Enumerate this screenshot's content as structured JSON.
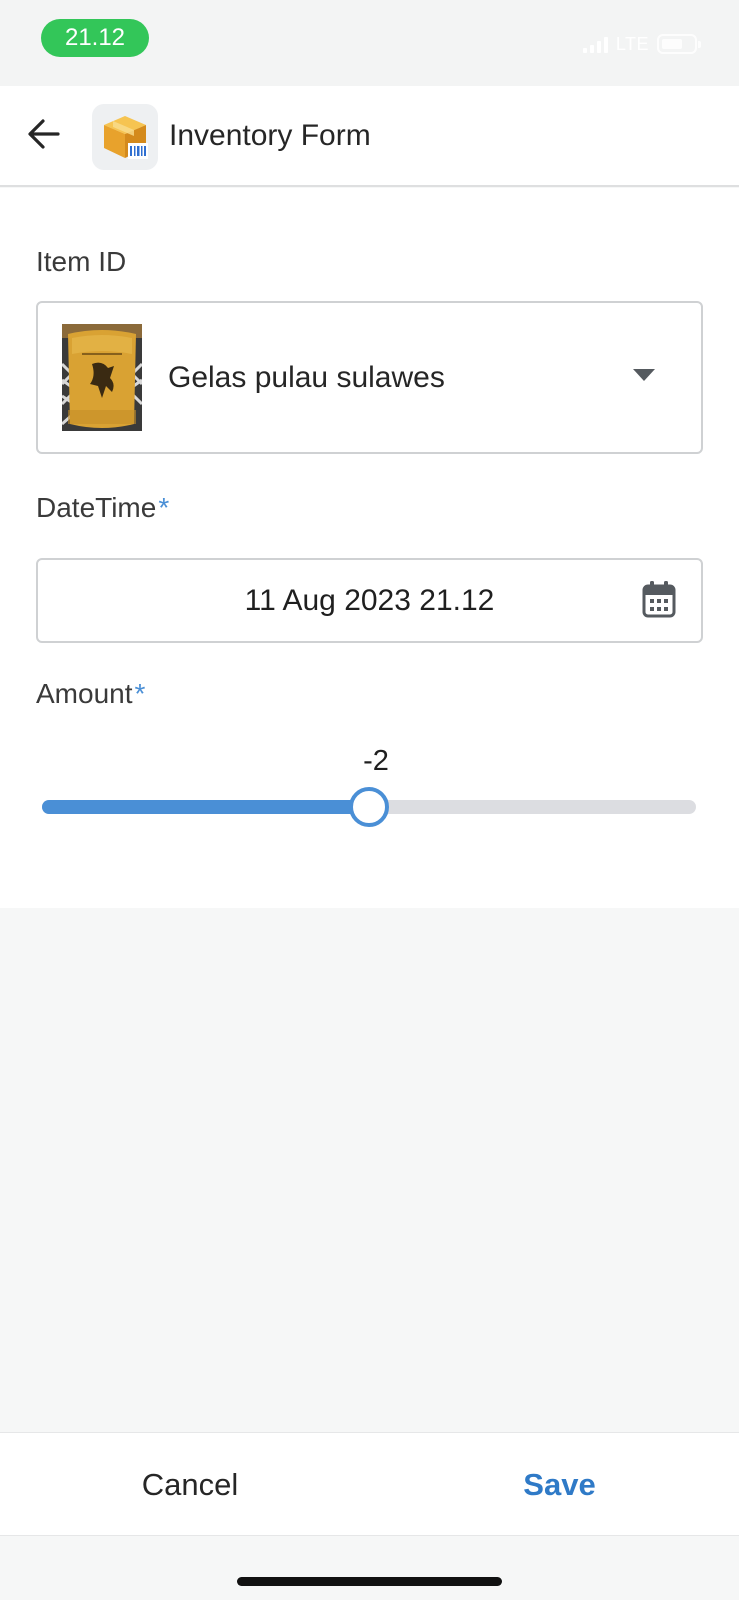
{
  "status_bar": {
    "time": "21.12",
    "network": "LTE"
  },
  "header": {
    "title": "Inventory Form",
    "back_icon": "arrow-left-icon",
    "app_icon": "package-barcode-icon"
  },
  "form": {
    "item_id": {
      "label": "Item ID",
      "value": "Gelas pulau sulawes",
      "thumbnail": "item-photo"
    },
    "datetime": {
      "label": "DateTime",
      "required_mark": "*",
      "value": "11 Aug 2023 21.12",
      "icon": "calendar-icon"
    },
    "amount": {
      "label": "Amount",
      "required_mark": "*",
      "value": "-2",
      "slider_fraction": 0.5
    }
  },
  "footer": {
    "cancel_label": "Cancel",
    "save_label": "Save"
  },
  "colors": {
    "accent": "#4a8fd6",
    "save": "#2f7ac7",
    "time_pill": "#33c659"
  }
}
